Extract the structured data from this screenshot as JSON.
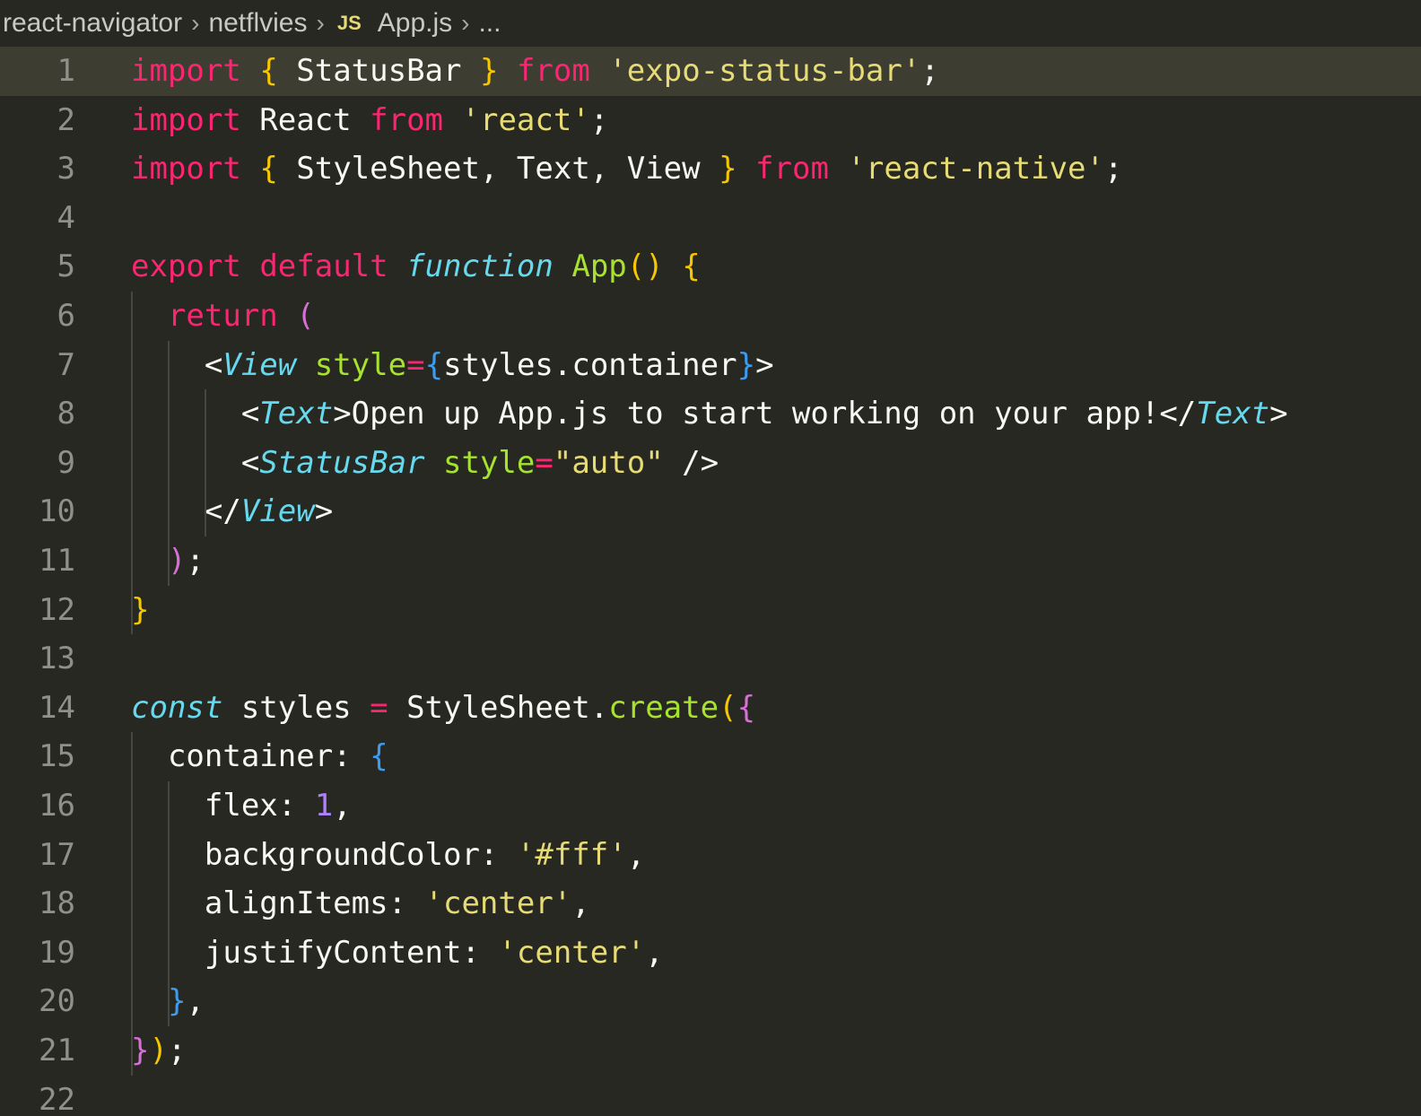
{
  "breadcrumb": {
    "items": [
      "react-navigator",
      "netflvies",
      "App.js",
      "..."
    ],
    "file_icon": "JS"
  },
  "editor": {
    "active_line": 1,
    "lines": [
      {
        "n": "1",
        "tokens": [
          [
            "kw",
            "import"
          ],
          [
            "plain",
            " "
          ],
          [
            "b1",
            "{"
          ],
          [
            "plain",
            " StatusBar "
          ],
          [
            "b1",
            "}"
          ],
          [
            "plain",
            " "
          ],
          [
            "kw",
            "from"
          ],
          [
            "plain",
            " "
          ],
          [
            "str",
            "'expo-status-bar'"
          ],
          [
            "plain",
            ";"
          ]
        ]
      },
      {
        "n": "2",
        "tokens": [
          [
            "kw",
            "import"
          ],
          [
            "plain",
            " React "
          ],
          [
            "kw",
            "from"
          ],
          [
            "plain",
            " "
          ],
          [
            "str",
            "'react'"
          ],
          [
            "plain",
            ";"
          ]
        ]
      },
      {
        "n": "3",
        "tokens": [
          [
            "kw",
            "import"
          ],
          [
            "plain",
            " "
          ],
          [
            "b1",
            "{"
          ],
          [
            "plain",
            " StyleSheet, Text, View "
          ],
          [
            "b1",
            "}"
          ],
          [
            "plain",
            " "
          ],
          [
            "kw",
            "from"
          ],
          [
            "plain",
            " "
          ],
          [
            "str",
            "'react-native'"
          ],
          [
            "plain",
            ";"
          ]
        ]
      },
      {
        "n": "4",
        "tokens": []
      },
      {
        "n": "5",
        "tokens": [
          [
            "kw",
            "export"
          ],
          [
            "plain",
            " "
          ],
          [
            "kw",
            "default"
          ],
          [
            "plain",
            " "
          ],
          [
            "st",
            "function"
          ],
          [
            "plain",
            " "
          ],
          [
            "fn",
            "App"
          ],
          [
            "b1",
            "()"
          ],
          [
            "plain",
            " "
          ],
          [
            "b1",
            "{"
          ]
        ]
      },
      {
        "n": "6",
        "tokens": [
          [
            "plain",
            "  "
          ],
          [
            "kw",
            "return"
          ],
          [
            "plain",
            " "
          ],
          [
            "b2",
            "("
          ]
        ]
      },
      {
        "n": "7",
        "tokens": [
          [
            "plain",
            "    <"
          ],
          [
            "tag",
            "View"
          ],
          [
            "plain",
            " "
          ],
          [
            "attr",
            "style"
          ],
          [
            "op",
            "="
          ],
          [
            "b3",
            "{"
          ],
          [
            "plain",
            "styles.container"
          ],
          [
            "b3",
            "}"
          ],
          [
            "plain",
            ">"
          ]
        ]
      },
      {
        "n": "8",
        "tokens": [
          [
            "plain",
            "      <"
          ],
          [
            "tag",
            "Text"
          ],
          [
            "plain",
            ">Open up App.js to start working on your app!</"
          ],
          [
            "tag",
            "Text"
          ],
          [
            "plain",
            ">"
          ]
        ]
      },
      {
        "n": "9",
        "tokens": [
          [
            "plain",
            "      <"
          ],
          [
            "tag",
            "StatusBar"
          ],
          [
            "plain",
            " "
          ],
          [
            "attr",
            "style"
          ],
          [
            "op",
            "="
          ],
          [
            "str",
            "\"auto\""
          ],
          [
            "plain",
            " />"
          ]
        ]
      },
      {
        "n": "10",
        "tokens": [
          [
            "plain",
            "    </"
          ],
          [
            "tag",
            "View"
          ],
          [
            "plain",
            ">"
          ]
        ]
      },
      {
        "n": "11",
        "tokens": [
          [
            "plain",
            "  "
          ],
          [
            "b2",
            ")"
          ],
          [
            "plain",
            ";"
          ]
        ]
      },
      {
        "n": "12",
        "tokens": [
          [
            "b1",
            "}"
          ]
        ]
      },
      {
        "n": "13",
        "tokens": []
      },
      {
        "n": "14",
        "tokens": [
          [
            "st",
            "const"
          ],
          [
            "plain",
            " styles "
          ],
          [
            "op",
            "="
          ],
          [
            "plain",
            " StyleSheet."
          ],
          [
            "fn",
            "create"
          ],
          [
            "b1",
            "("
          ],
          [
            "b2",
            "{"
          ]
        ]
      },
      {
        "n": "15",
        "tokens": [
          [
            "plain",
            "  container: "
          ],
          [
            "b3",
            "{"
          ]
        ]
      },
      {
        "n": "16",
        "tokens": [
          [
            "plain",
            "    flex: "
          ],
          [
            "num",
            "1"
          ],
          [
            "plain",
            ","
          ]
        ]
      },
      {
        "n": "17",
        "tokens": [
          [
            "plain",
            "    backgroundColor: "
          ],
          [
            "str",
            "'#fff'"
          ],
          [
            "plain",
            ","
          ]
        ]
      },
      {
        "n": "18",
        "tokens": [
          [
            "plain",
            "    alignItems: "
          ],
          [
            "str",
            "'center'"
          ],
          [
            "plain",
            ","
          ]
        ]
      },
      {
        "n": "19",
        "tokens": [
          [
            "plain",
            "    justifyContent: "
          ],
          [
            "str",
            "'center'"
          ],
          [
            "plain",
            ","
          ]
        ]
      },
      {
        "n": "20",
        "tokens": [
          [
            "plain",
            "  "
          ],
          [
            "b3",
            "}"
          ],
          [
            "plain",
            ","
          ]
        ]
      },
      {
        "n": "21",
        "tokens": [
          [
            "b2",
            "}"
          ],
          [
            "b1",
            ")"
          ],
          [
            "plain",
            ";"
          ]
        ]
      },
      {
        "n": "22",
        "tokens": []
      }
    ]
  },
  "colors": {
    "background": "#272822",
    "active_line": "#3e3d32",
    "keyword": "#f92672",
    "string": "#e6db74",
    "function": "#a6e22e",
    "storage": "#66d9ef",
    "number": "#ae81ff"
  }
}
